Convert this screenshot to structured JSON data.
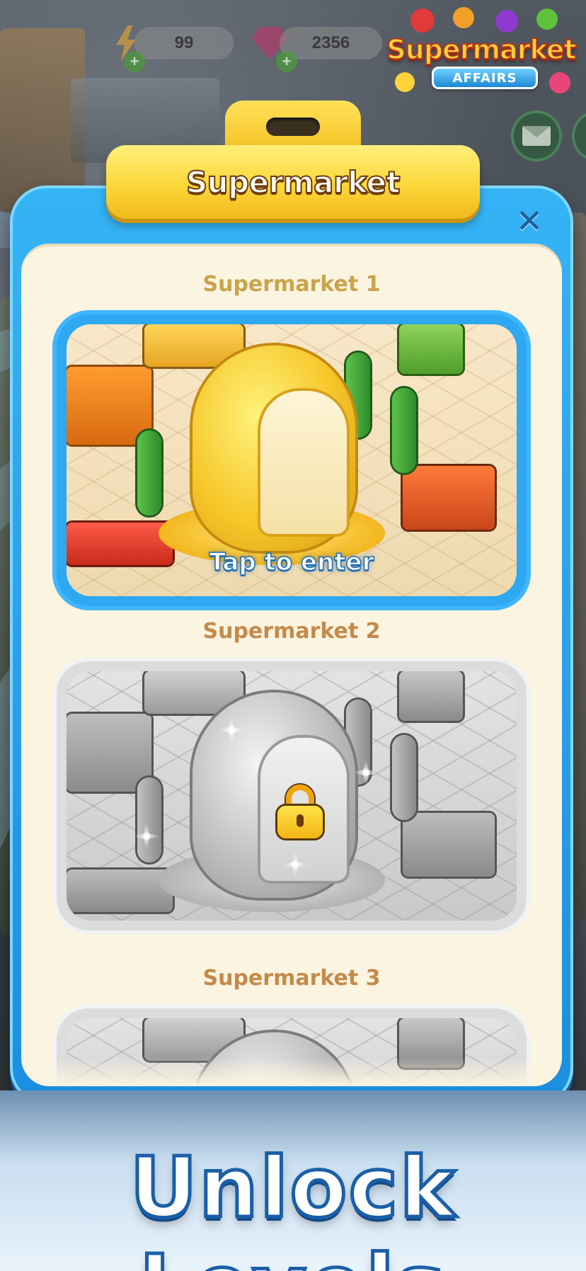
{
  "hud": {
    "energy_value": "99",
    "energy_timer": "",
    "gems_value": "2356"
  },
  "logo": {
    "title": "Supermarket",
    "subtitle": "AFFAIRS"
  },
  "dialog": {
    "title": "Supermarket",
    "close_symbol": "✕",
    "levels": [
      {
        "label": "Supermarket 1",
        "status": "unlocked",
        "action_text": "Tap to enter"
      },
      {
        "label": "Supermarket 2",
        "status": "locked"
      },
      {
        "label": "Supermarket 3",
        "status": "locked"
      }
    ]
  },
  "caption": "Unlock Levels",
  "icons": {
    "energy": "lightning-icon",
    "gems": "gem-icon",
    "mail": "mail-icon",
    "close": "close-icon",
    "lock": "padlock-icon"
  },
  "colors": {
    "dialog_frame": "#1c8fe0",
    "dialog_bg": "#fbf4e1",
    "banner": "#fbd73a",
    "caption_stroke": "#1a5fa8"
  }
}
